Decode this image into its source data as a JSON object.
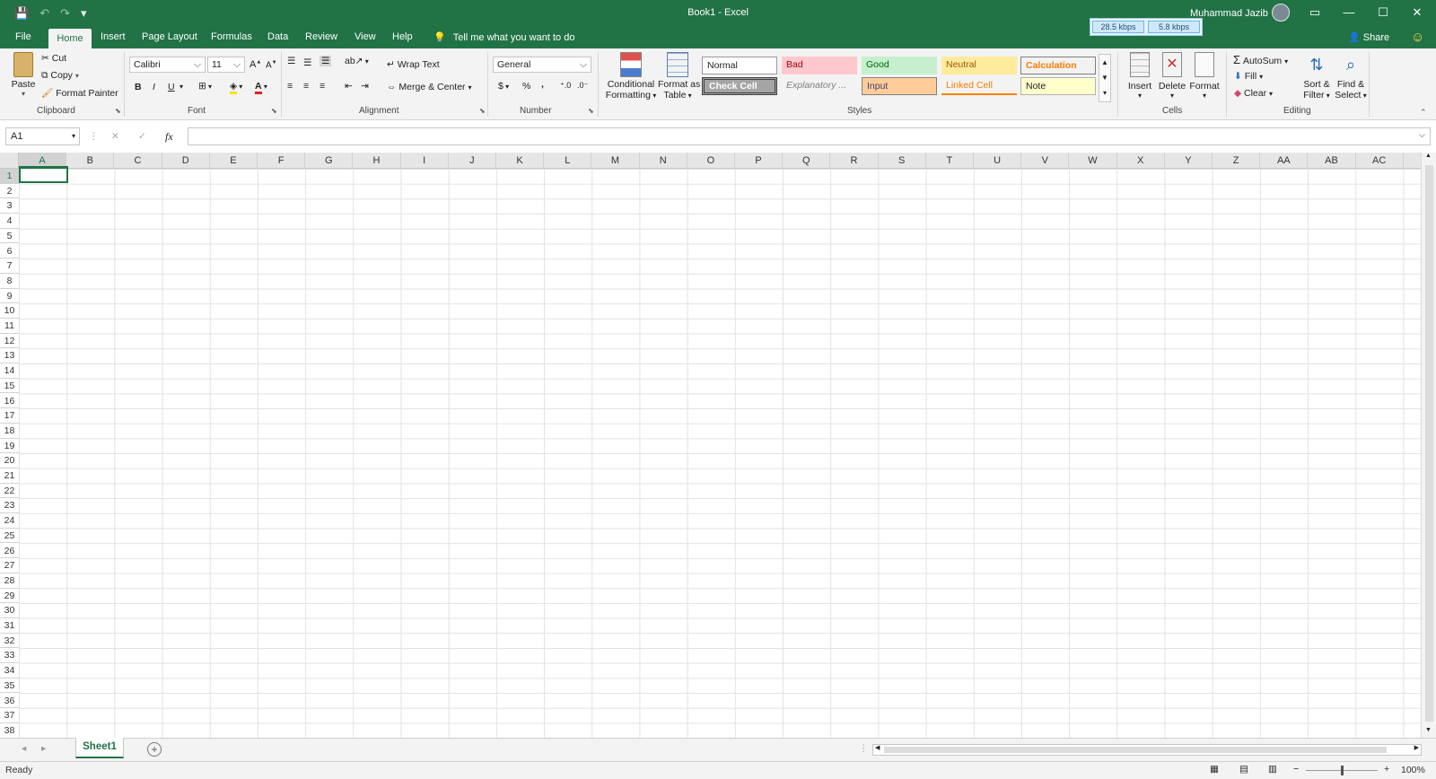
{
  "window": {
    "title": "Book1  -  Excel",
    "user": "Muhammad Jazib",
    "speed_up": "28.5 kbps",
    "speed_down": "5.8 kbps",
    "minimize": "—",
    "maximize": "☐",
    "close": "✕",
    "ribbon_display": "▭"
  },
  "tabs": [
    "File",
    "Home",
    "Insert",
    "Page Layout",
    "Formulas",
    "Data",
    "Review",
    "View",
    "Help"
  ],
  "tell_me": "Tell me what you want to do",
  "share": "Share",
  "ribbon": {
    "clipboard": {
      "paste": "Paste",
      "cut": "Cut",
      "copy": "Copy",
      "format_painter": "Format Painter",
      "label": "Clipboard"
    },
    "font": {
      "family": "Calibri",
      "size": "11",
      "bold": "B",
      "italic": "I",
      "underline": "U",
      "label": "Font"
    },
    "alignment": {
      "wrap_text": "Wrap Text",
      "merge_center": "Merge & Center",
      "label": "Alignment"
    },
    "number": {
      "format": "General",
      "currency": "$",
      "percent": "%",
      "comma": ",",
      "label": "Number"
    },
    "styles": {
      "conditional": "Conditional",
      "conditional_2": "Formatting",
      "format_table": "Format as",
      "format_table_2": "Table",
      "items": [
        "Normal",
        "Bad",
        "Good",
        "Neutral",
        "Calculation",
        "Check Cell",
        "Explanatory ...",
        "Input",
        "Linked Cell",
        "Note"
      ],
      "label": "Styles"
    },
    "cells": {
      "insert": "Insert",
      "delete": "Delete",
      "format": "Format",
      "label": "Cells"
    },
    "editing": {
      "autosum": "AutoSum",
      "fill": "Fill",
      "clear": "Clear",
      "sort": "Sort &",
      "sort_2": "Filter",
      "find": "Find &",
      "find_2": "Select",
      "label": "Editing"
    }
  },
  "formula_bar": {
    "name_box": "A1",
    "fx": "fx",
    "cancel": "✕",
    "enter": "✓",
    "value": ""
  },
  "columns": [
    "A",
    "B",
    "C",
    "D",
    "E",
    "F",
    "G",
    "H",
    "I",
    "J",
    "K",
    "L",
    "M",
    "N",
    "O",
    "P",
    "Q",
    "R",
    "S",
    "T",
    "U",
    "V",
    "W",
    "X",
    "Y",
    "Z",
    "AA",
    "AB",
    "AC"
  ],
  "rows": [
    "1",
    "2",
    "3",
    "4",
    "5",
    "6",
    "7",
    "8",
    "9",
    "10",
    "11",
    "12",
    "13",
    "14",
    "15",
    "16",
    "17",
    "18",
    "19",
    "20",
    "21",
    "22",
    "23",
    "24",
    "25",
    "26",
    "27",
    "28",
    "29",
    "30",
    "31",
    "32",
    "33",
    "34",
    "35",
    "36",
    "37",
    "38"
  ],
  "sheets": [
    "Sheet1"
  ],
  "status": {
    "text": "Ready",
    "zoom": "100%"
  }
}
